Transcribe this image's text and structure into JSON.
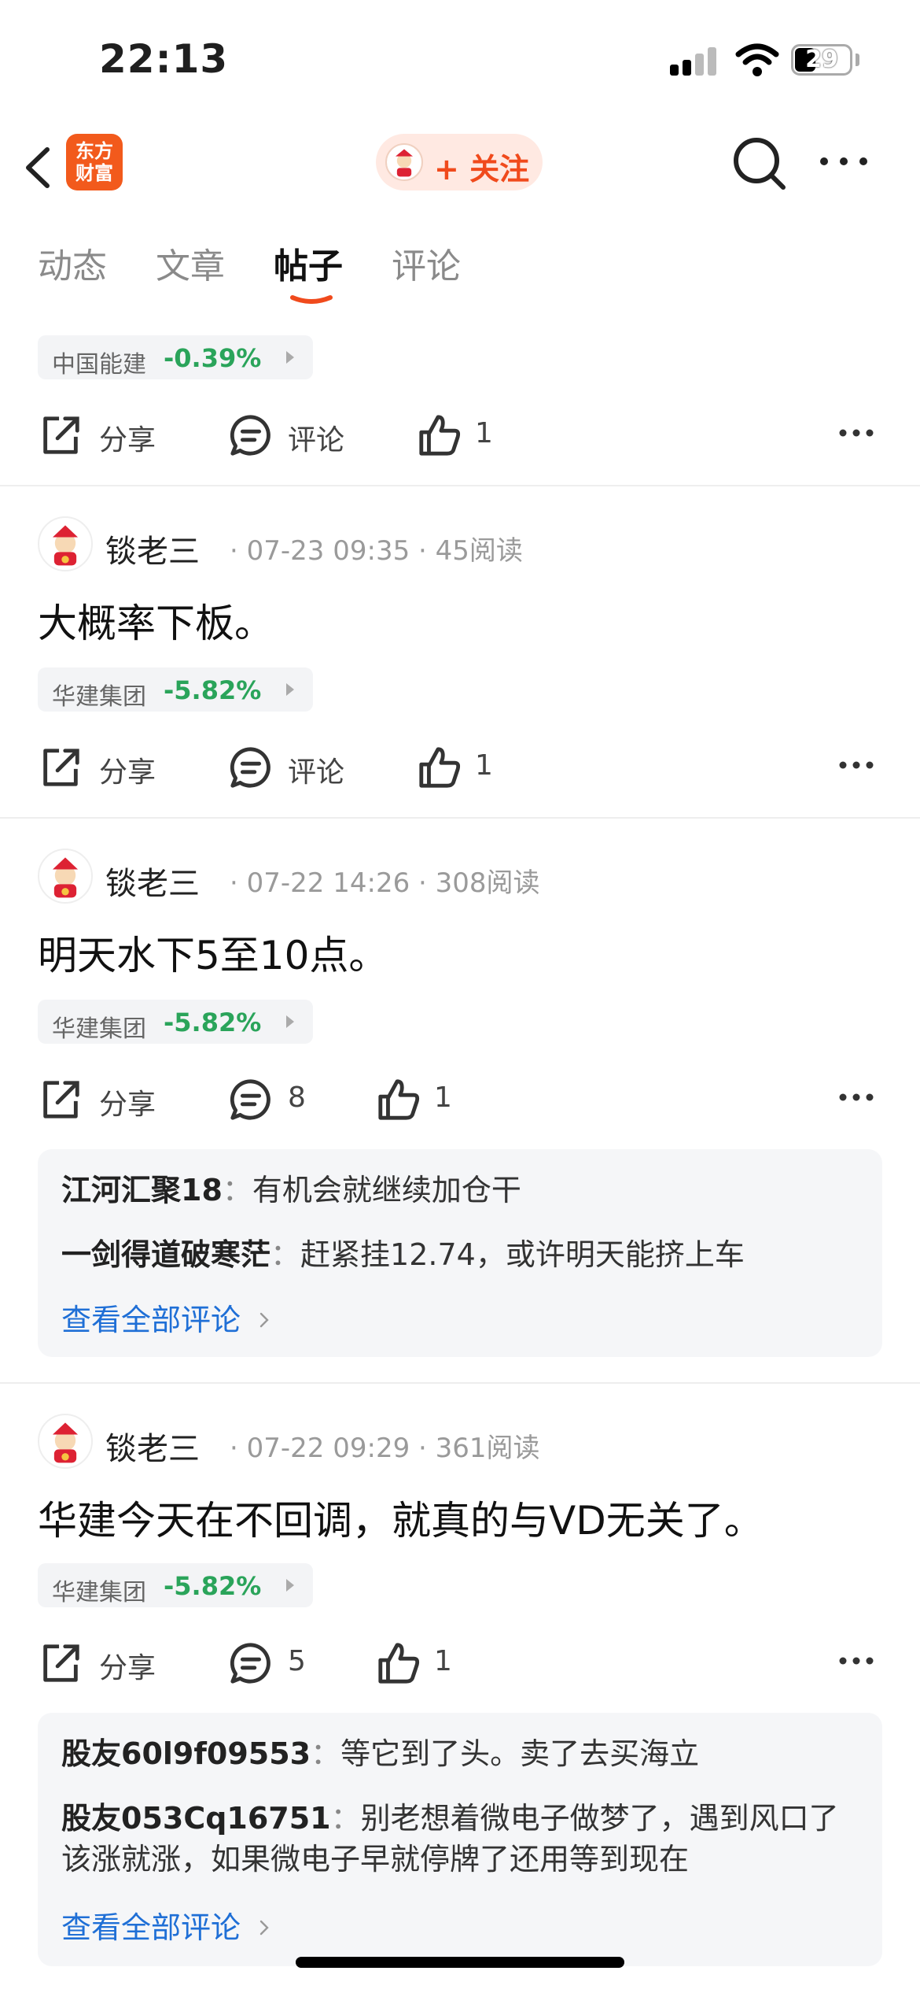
{
  "status_bar": {
    "time": "22:13",
    "battery": "29"
  },
  "nav": {
    "app_logo_line1": "东方",
    "app_logo_line2": "财富",
    "follow_label": "+ 关注"
  },
  "tabs": [
    {
      "label": "动态",
      "active": false
    },
    {
      "label": "文章",
      "active": false
    },
    {
      "label": "帖子",
      "active": true
    },
    {
      "label": "评论",
      "active": false
    }
  ],
  "colors": {
    "accent": "#f04a1c",
    "down_green": "#2aa45a",
    "link_blue": "#1f6fd6"
  },
  "actions_labels": {
    "share": "分享",
    "comment": "评论"
  },
  "posts": [
    {
      "partial": true,
      "stock": {
        "name": "中国能建",
        "change": "-0.39%"
      },
      "comments_label": "评论",
      "likes": "1"
    },
    {
      "author": "锬老三",
      "time": "07-23 09:35",
      "reads": "45阅读",
      "text": "大概率下板。",
      "stock": {
        "name": "华建集团",
        "change": "-5.82%"
      },
      "comments_label": "评论",
      "likes": "1"
    },
    {
      "author": "锬老三",
      "time": "07-22 14:26",
      "reads": "308阅读",
      "text": "明天水下5至10点。",
      "stock": {
        "name": "华建集团",
        "change": "-5.82%"
      },
      "comments_label": "8",
      "likes": "1",
      "comments": [
        {
          "user": "江河汇聚18",
          "text": "有机会就继续加仓干"
        },
        {
          "user": "一剑得道破寒茫",
          "text": "赶紧挂12.74，或许明天能挤上车"
        }
      ],
      "view_all": "查看全部评论"
    },
    {
      "author": "锬老三",
      "time": "07-22 09:29",
      "reads": "361阅读",
      "text": "华建今天在不回调，就真的与VD无关了。",
      "stock": {
        "name": "华建集团",
        "change": "-5.82%"
      },
      "comments_label": "5",
      "likes": "1",
      "comments": [
        {
          "user": "股友60l9f09553",
          "text": "等它到了头。卖了去买海立"
        },
        {
          "user": "股友053Cq16751",
          "text": "别老想着微电子做梦了，遇到风口了该涨就涨，如果微电子早就停牌了还用等到现在"
        }
      ],
      "view_all": "查看全部评论"
    }
  ],
  "meta_separator": "·",
  "comment_separator": "："
}
